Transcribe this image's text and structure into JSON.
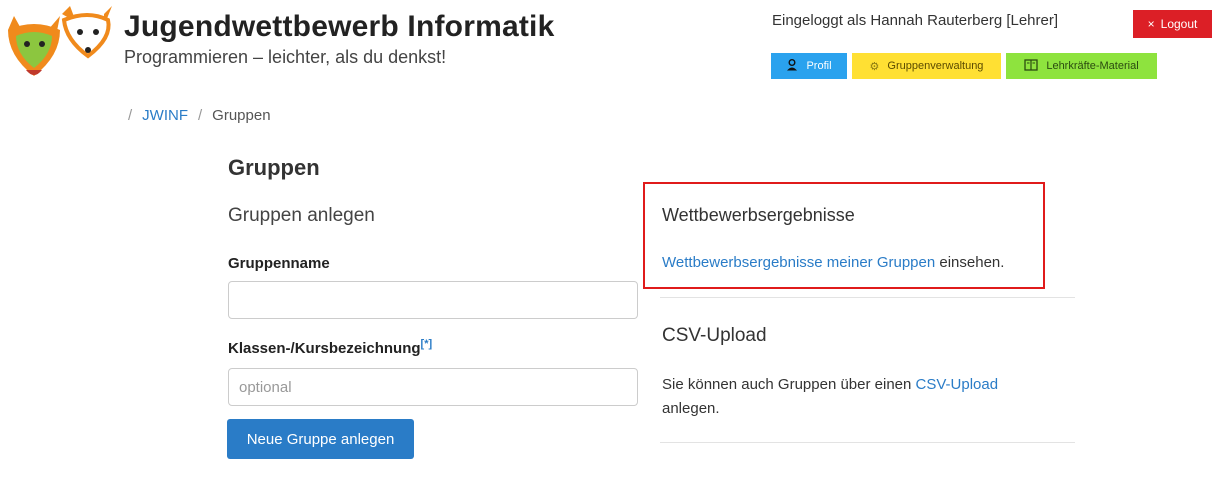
{
  "header": {
    "title": "Jugendwettbewerb Informatik",
    "subtitle": "Programmieren – leichter, als du denkst!",
    "login_info": "Eingeloggt als Hannah Rauterberg [Lehrer]",
    "logout_label": "Logout",
    "nav": {
      "profil": "Profil",
      "gruppenverwaltung": "Gruppenverwaltung",
      "material": "Lehrkräfte-Material"
    }
  },
  "breadcrumb": {
    "home": "JWINF",
    "current": "Gruppen",
    "separator": "/"
  },
  "main": {
    "title": "Gruppen",
    "anlegen_heading": "Gruppen anlegen",
    "gruppenname_label": "Gruppenname",
    "gruppenname_value": "",
    "klasse_label": "Klassen-/Kursbezeichnung",
    "klasse_footnote": "[*]",
    "klasse_placeholder": "optional",
    "submit_label": "Neue Gruppe anlegen"
  },
  "sidebar": {
    "wett_heading": "Wettbewerbsergebnisse",
    "wett_link": "Wettbewerbsergebnisse meiner Gruppen",
    "wett_suffix": " einsehen.",
    "csv_heading": "CSV-Upload",
    "csv_prefix": "Sie können auch Gruppen über einen ",
    "csv_link": "CSV-Upload",
    "csv_suffix": " anlegen."
  },
  "colors": {
    "logout": "#dc1f26",
    "profil": "#2aa2ee",
    "gruppenverwaltung": "#ffe033",
    "material": "#8ee33e",
    "link": "#2a7cc7",
    "highlight_box": "#e01b1b"
  },
  "icons": [
    "fox-logo-icon",
    "close-icon",
    "user-icon",
    "gear-icon",
    "book-icon"
  ]
}
